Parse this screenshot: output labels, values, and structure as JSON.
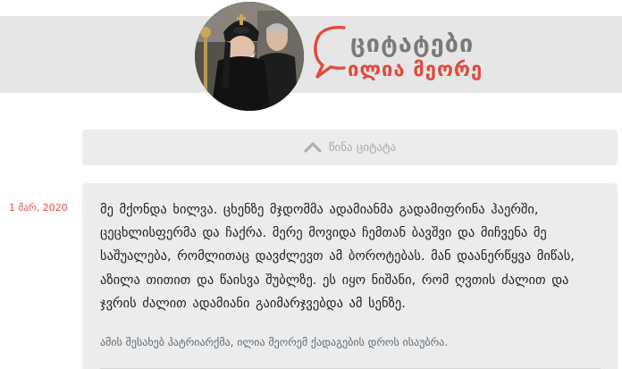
{
  "brand": {
    "title": "ციტატები",
    "subtitle": "ილია მეორე",
    "accent_color": "#e24a3b",
    "title_color": "#7a7a7a"
  },
  "avatar": {
    "icon": "portrait-photo"
  },
  "nav": {
    "prev_label": "წინა ციტატა",
    "prev_icon": "chevron-up-icon"
  },
  "quote": {
    "date": "1 მარ, 2020",
    "text": "მე მქონდა ხილვა. ცხენზე მჯდომმა ადამიანმა გადამიფრინა ჰაერში, ცეცხლისფერმა და ჩაქრა. მერე მოვიდა ჩემთან ბავშვი და მიჩვენა მე საშუალება, რომლითაც დავძლევთ ამ ბოროტებას. მან დაანერწყვა მიწას, აზილა თითით და წაისვა შუბლზე. ეს იყო ნიშანი, რომ ღვთის ძალით და ჯვრის ძალით ადამიანი გაიმარჯვებდა ამ სენზე.",
    "note": "ამის შესახებ პატრიარქმა, ილია მეორემ ქადაგების დროს ისაუბრა."
  }
}
